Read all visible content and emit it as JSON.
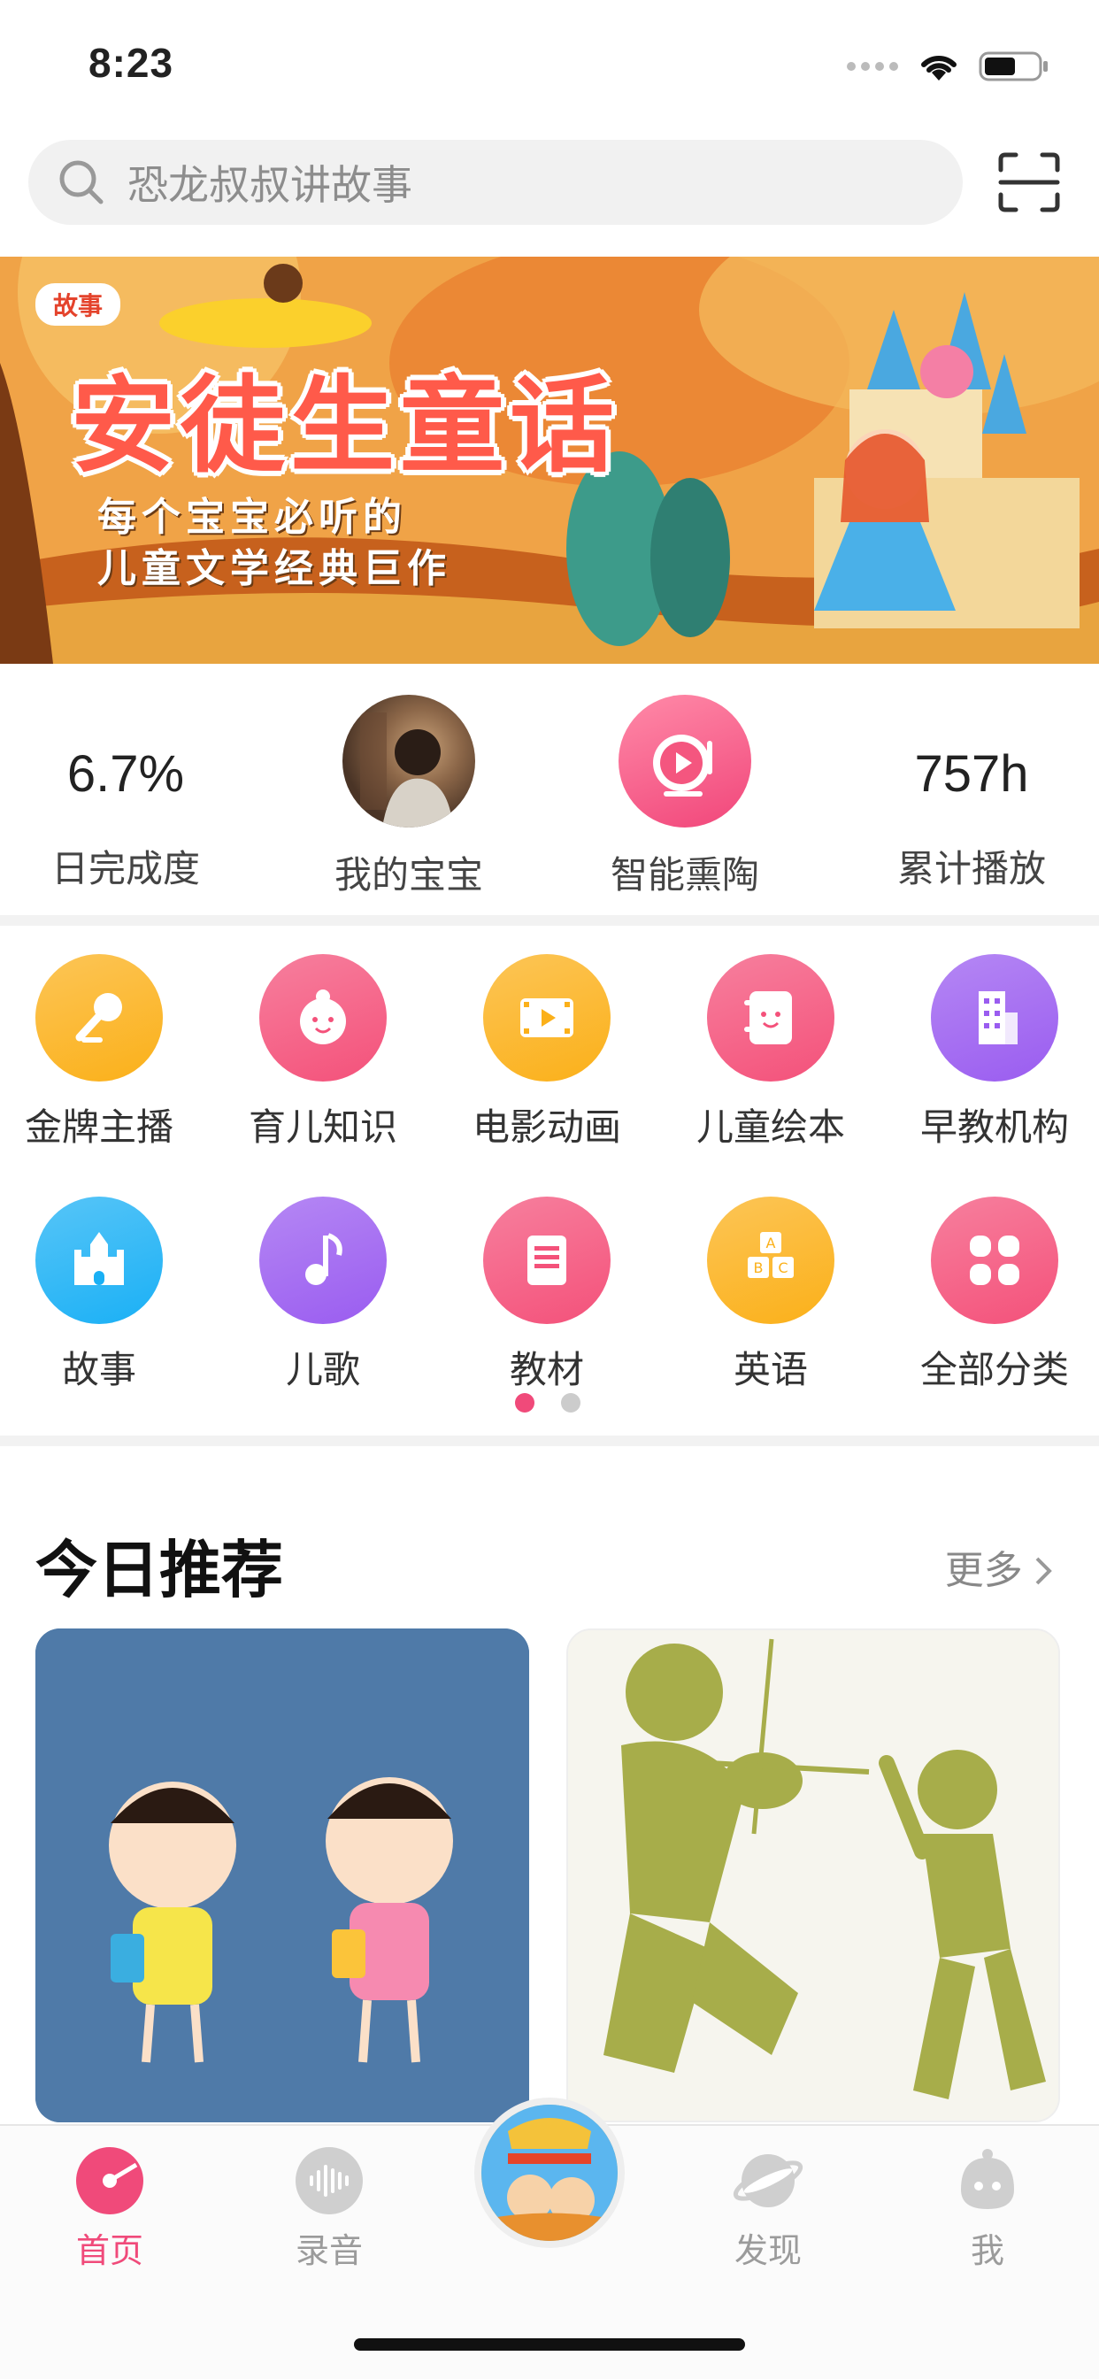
{
  "status_bar": {
    "time": "8:23"
  },
  "search": {
    "placeholder": "恐龙叔叔讲故事"
  },
  "banner": {
    "tag": "故事",
    "title": "安徒生童话",
    "subtitle_line1": "每个宝宝必听的",
    "subtitle_line2": "儿童文学经典巨作",
    "page_index": 4,
    "page_count": 4
  },
  "stats": [
    {
      "value": "6.7%",
      "label": "日完成度"
    },
    {
      "value": "",
      "label": "我的宝宝"
    },
    {
      "value": "",
      "label": "智能熏陶"
    },
    {
      "value": "757h",
      "label": "累计播放"
    }
  ],
  "categories": [
    {
      "label": "金牌主播",
      "icon": "microphone-icon",
      "color": "#fbb019"
    },
    {
      "label": "育儿知识",
      "icon": "baby-face-icon",
      "color": "#f4517a"
    },
    {
      "label": "电影动画",
      "icon": "film-icon",
      "color": "#fbb019"
    },
    {
      "label": "儿童绘本",
      "icon": "notebook-icon",
      "color": "#f4517a"
    },
    {
      "label": "早教机构",
      "icon": "building-icon",
      "color": "#9a5cf0"
    },
    {
      "label": "故事",
      "icon": "castle-icon",
      "color": "#1ab0f5"
    },
    {
      "label": "儿歌",
      "icon": "music-note-icon",
      "color": "#9a5cf0"
    },
    {
      "label": "教材",
      "icon": "book-icon",
      "color": "#f4517a"
    },
    {
      "label": "英语",
      "icon": "abc-blocks-icon",
      "color": "#fbb019"
    },
    {
      "label": "全部分类",
      "icon": "grid-icon",
      "color": "#f4517a"
    }
  ],
  "category_pager": {
    "current": 1,
    "count": 2
  },
  "today": {
    "title": "今日推荐",
    "more": "更多"
  },
  "tabs": [
    {
      "label": "首页",
      "icon": "record-disc-icon",
      "active": true
    },
    {
      "label": "录音",
      "icon": "waveform-icon",
      "active": false
    },
    {
      "label": "发现",
      "icon": "planet-icon",
      "active": false
    },
    {
      "label": "我",
      "icon": "profile-face-icon",
      "active": false
    }
  ],
  "colors": {
    "accent": "#f04a7a",
    "tab_inactive": "#9b9b9b"
  }
}
